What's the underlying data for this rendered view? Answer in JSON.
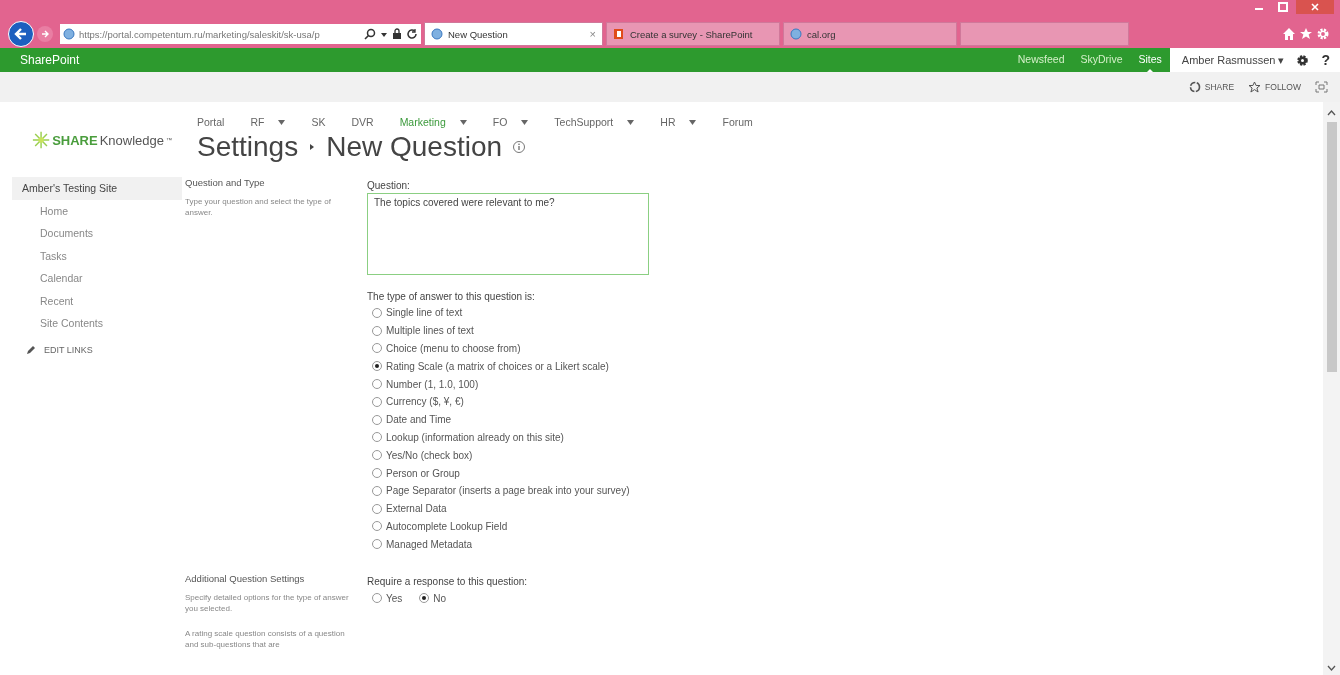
{
  "browser": {
    "address": "https://portal.competentum.ru/marketing/saleskit/sk-usa/p",
    "tabs": [
      {
        "label": "New Question",
        "selected": true,
        "close": "×"
      },
      {
        "label": "Create a survey - SharePoint",
        "selected": false
      },
      {
        "label": "cal.org",
        "selected": false
      }
    ]
  },
  "suite_bar": {
    "brand": "SharePoint",
    "links": [
      {
        "label": "Newsfeed",
        "selected": false
      },
      {
        "label": "SkyDrive",
        "selected": false
      },
      {
        "label": "Sites",
        "selected": true
      }
    ],
    "user": "Amber Rasmussen ▾",
    "help": "?"
  },
  "ribbon": {
    "actions": [
      "SHARE",
      "FOLLOW"
    ]
  },
  "logo": {
    "strong": "SHARE",
    "rest": "Knowledge",
    "tm": "™"
  },
  "top_nav": [
    {
      "label": "Portal",
      "menu": false,
      "selected": false
    },
    {
      "label": "RF",
      "menu": true,
      "selected": false
    },
    {
      "label": "SK",
      "menu": false,
      "selected": false
    },
    {
      "label": "DVR",
      "menu": false,
      "selected": false
    },
    {
      "label": "Marketing",
      "menu": true,
      "selected": true
    },
    {
      "label": "FO",
      "menu": true,
      "selected": false
    },
    {
      "label": "TechSupport",
      "menu": true,
      "selected": false
    },
    {
      "label": "HR",
      "menu": true,
      "selected": false
    },
    {
      "label": "Forum",
      "menu": false,
      "selected": false
    }
  ],
  "page_title": {
    "parent": "Settings",
    "current": "New Question"
  },
  "sidebar": {
    "items": [
      {
        "label": "Amber's Testing Site",
        "selected": true,
        "children": [
          {
            "label": "Home",
            "selected": false
          },
          {
            "label": "Documents",
            "selected": false
          },
          {
            "label": "Tasks",
            "selected": false
          },
          {
            "label": "Calendar",
            "selected": false
          },
          {
            "label": "Recent",
            "selected": false
          },
          {
            "label": "Site Contents",
            "selected": false
          }
        ]
      }
    ],
    "edit_links": "EDIT LINKS"
  },
  "sections": [
    {
      "title": "Question and Type",
      "descriptions": [
        "Type your question and select the type of answer."
      ],
      "fields": [
        {
          "kind": "textarea",
          "label": "Question:",
          "value": "The topics covered were relevant to me?"
        },
        {
          "kind": "radio_list",
          "label": "The type of answer to this question is:",
          "options": [
            {
              "label": "Single line of text",
              "selected": false
            },
            {
              "label": "Multiple lines of text",
              "selected": false
            },
            {
              "label": "Choice (menu to choose from)",
              "selected": false
            },
            {
              "label": "Rating Scale (a matrix of choices or a Likert scale)",
              "selected": true
            },
            {
              "label": "Number (1, 1.0, 100)",
              "selected": false
            },
            {
              "label": "Currency ($, ¥, €)",
              "selected": false
            },
            {
              "label": "Date and Time",
              "selected": false
            },
            {
              "label": "Lookup (information already on this site)",
              "selected": false
            },
            {
              "label": "Yes/No (check box)",
              "selected": false
            },
            {
              "label": "Person or Group",
              "selected": false
            },
            {
              "label": "Page Separator (inserts a page break into your survey)",
              "selected": false
            },
            {
              "label": "External Data",
              "selected": false
            },
            {
              "label": "Autocomplete Lookup Field",
              "selected": false
            },
            {
              "label": "Managed Metadata",
              "selected": false
            }
          ]
        }
      ]
    },
    {
      "title": "Additional Question Settings",
      "descriptions": [
        "Specify detailed options for the type of answer you selected.",
        "A rating scale question consists of a question and sub-questions that are"
      ],
      "fields": [
        {
          "kind": "radio_row",
          "label": "Require a response to this question:",
          "options": [
            {
              "label": "Yes",
              "selected": false
            },
            {
              "label": "No",
              "selected": true
            }
          ]
        }
      ]
    }
  ]
}
